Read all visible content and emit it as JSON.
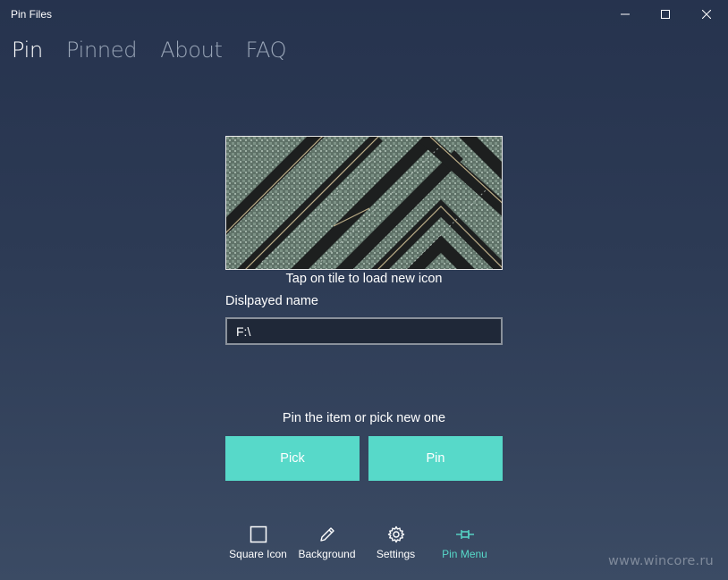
{
  "window": {
    "title": "Pin Files",
    "minimize_icon": "minimize-icon",
    "maximize_icon": "maximize-icon",
    "close_icon": "close-icon"
  },
  "nav": {
    "tabs": [
      {
        "label": "Pin",
        "active": true
      },
      {
        "label": "Pinned",
        "active": false
      },
      {
        "label": "About",
        "active": false
      },
      {
        "label": "FAQ",
        "active": false
      }
    ]
  },
  "main": {
    "tile_hint": "Tap on tile to load new icon",
    "name_label": "Dislpayed name",
    "name_value": "F:\\",
    "pin_hint": "Pin the item or pick new one",
    "pick_label": "Pick",
    "pin_label": "Pin"
  },
  "commandbar": {
    "items": [
      {
        "label": "Square Icon",
        "icon": "square-icon"
      },
      {
        "label": "Background",
        "icon": "pencil-icon"
      },
      {
        "label": "Settings",
        "icon": "gear-icon"
      },
      {
        "label": "Pin Menu",
        "icon": "pin-icon"
      }
    ]
  },
  "colors": {
    "accent": "#57d9c9",
    "background_top": "#26334e",
    "background_bottom": "#3b4b64"
  },
  "watermark": "www.wincore.ru"
}
